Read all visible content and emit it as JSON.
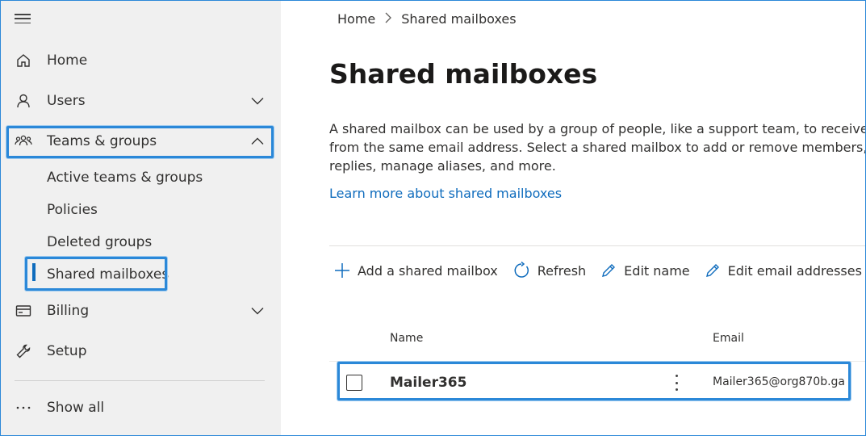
{
  "sidebar": {
    "items": [
      {
        "label": "Home",
        "icon": "home-icon"
      },
      {
        "label": "Users",
        "icon": "user-icon"
      },
      {
        "label": "Teams & groups",
        "icon": "teams-icon"
      },
      {
        "label": "Billing",
        "icon": "billing-icon"
      },
      {
        "label": "Setup",
        "icon": "wrench-icon"
      },
      {
        "label": "Show all",
        "icon": "more-icon"
      }
    ],
    "subitems": [
      "Active teams & groups",
      "Policies",
      "Deleted groups",
      "Shared mailboxes"
    ],
    "selected": "Shared mailboxes"
  },
  "breadcrumb": [
    "Home",
    "Shared mailboxes"
  ],
  "page": {
    "title": "Shared mailboxes",
    "description_lines": [
      "A shared mailbox can be used by a group of people, like a support team, to receive an",
      "from the same email address. Select a shared mailbox to add or remove members, set",
      "replies, manage aliases, and more."
    ],
    "learn_link": "Learn more about shared mailboxes"
  },
  "commands": [
    {
      "label": "Add a shared mailbox",
      "icon": "plus-icon"
    },
    {
      "label": "Refresh",
      "icon": "refresh-icon"
    },
    {
      "label": "Edit name",
      "icon": "pencil-icon"
    },
    {
      "label": "Edit email addresses",
      "icon": "pencil-icon"
    }
  ],
  "table": {
    "columns": [
      "Name",
      "Email"
    ],
    "rows": [
      {
        "name": "Mailer365",
        "email": "Mailer365@org870b.ga"
      }
    ]
  },
  "colors": {
    "accent": "#0f6cbd",
    "highlight": "#2b88d8",
    "sidebar_bg": "#f0f0f0"
  }
}
